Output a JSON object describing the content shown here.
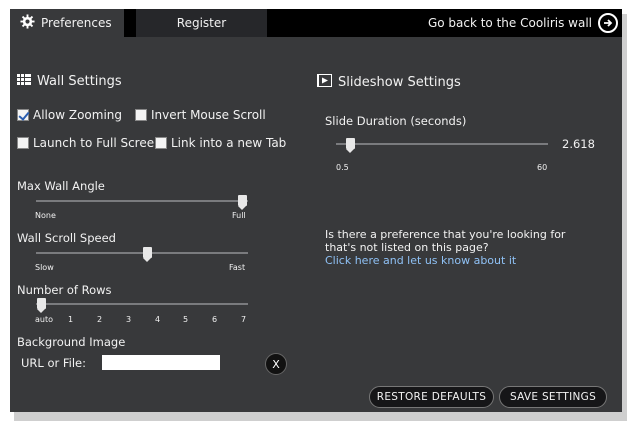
{
  "tabs": {
    "preferences": "Preferences",
    "register": "Register",
    "back_link": "Go back to the Cooliris wall"
  },
  "wall": {
    "title": "Wall Settings",
    "checkboxes": [
      {
        "label": "Allow Zooming",
        "checked": true
      },
      {
        "label": "Invert Mouse Scroll",
        "checked": false
      },
      {
        "label": "Launch to Full Screen",
        "checked": false
      },
      {
        "label": "Link into a new Tab",
        "checked": false
      }
    ],
    "max_angle": {
      "label": "Max Wall Angle",
      "min_label": "None",
      "max_label": "Full",
      "value_fraction": 1.0
    },
    "scroll_speed": {
      "label": "Wall Scroll Speed",
      "min_label": "Slow",
      "max_label": "Fast",
      "value_fraction": 0.5
    },
    "rows": {
      "label": "Number of Rows",
      "ticks": [
        "auto",
        "1",
        "2",
        "3",
        "4",
        "5",
        "6",
        "7"
      ],
      "selected": "auto"
    },
    "background": {
      "label": "Background Image",
      "url_label": "URL or File:",
      "url_value": "",
      "clear_label": "X"
    }
  },
  "slideshow": {
    "title": "Slideshow Settings",
    "duration_label": "Slide Duration (seconds)",
    "duration_value": "2.618",
    "min_label": "0.5",
    "max_label": "60"
  },
  "question": {
    "text": "Is there a preference that you're looking for that's not listed on this page?",
    "link": "Click here and let us know about it"
  },
  "buttons": {
    "restore": "RESTORE DEFAULTS",
    "save": "SAVE SETTINGS"
  },
  "icons": {
    "preferences": "gear-icon",
    "back": "circle-arrow-right-icon",
    "wall": "grid-icon",
    "slideshow": "slideshow-icon"
  }
}
